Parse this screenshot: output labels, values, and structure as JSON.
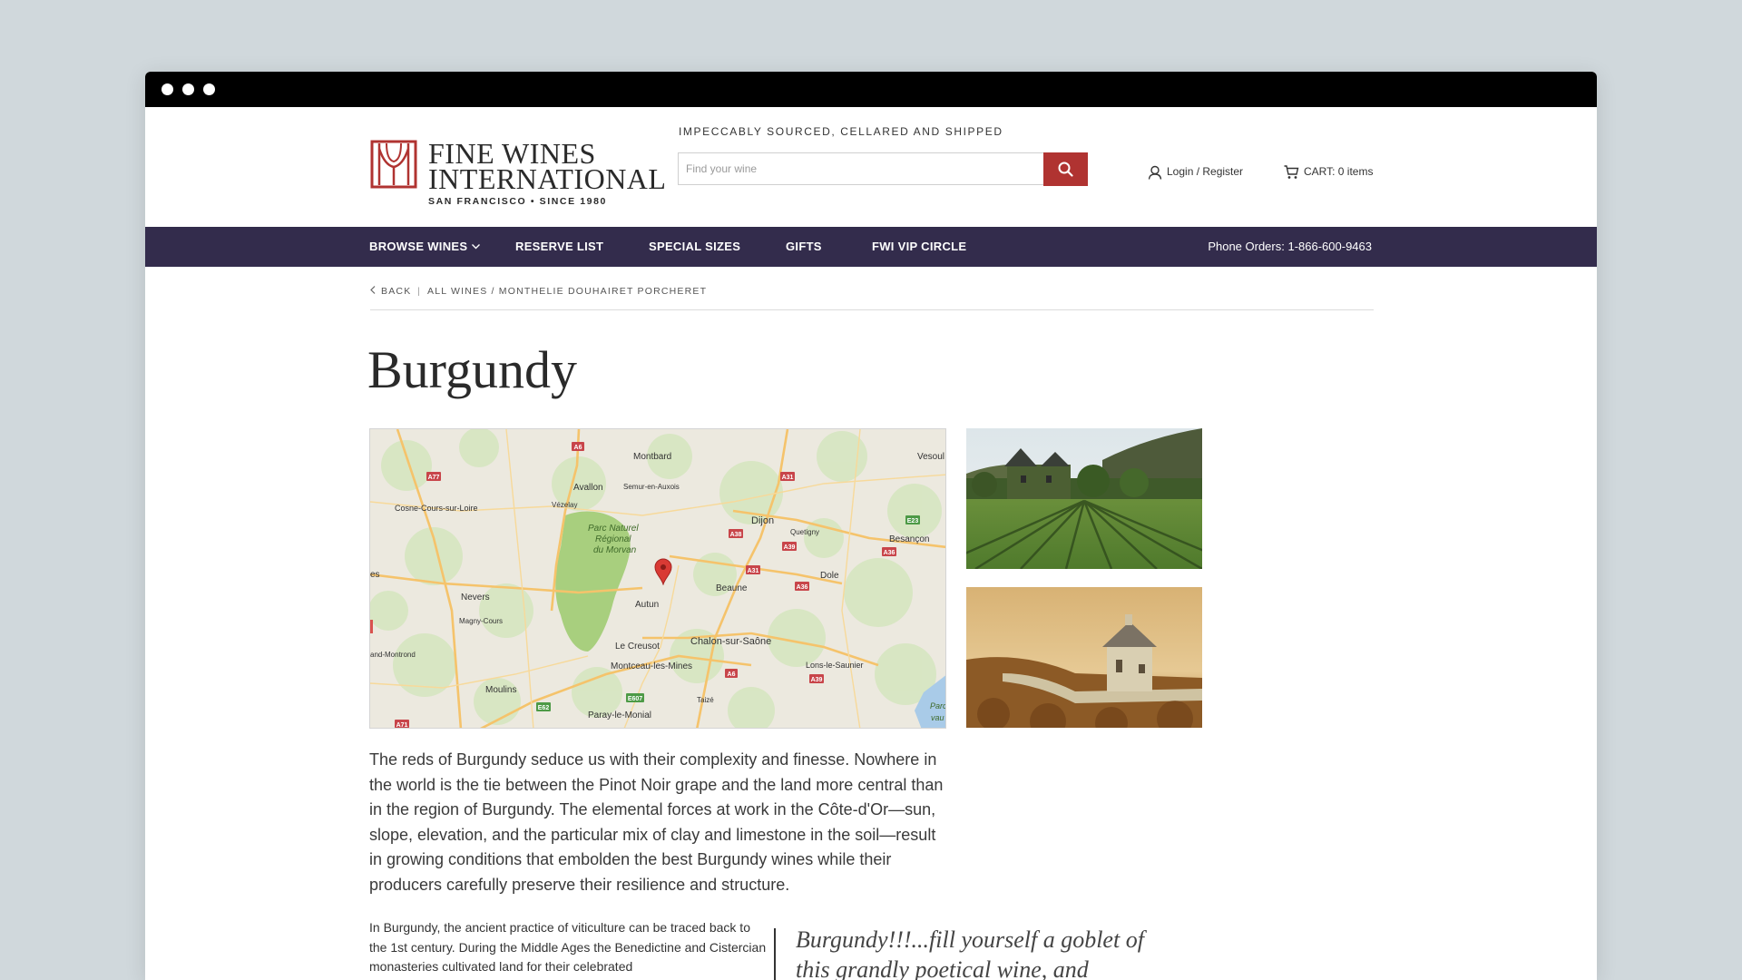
{
  "brand": {
    "line1": "FINE WINES",
    "line2": "INTERNATIONAL",
    "subline": "SAN FRANCISCO • SINCE 1980",
    "accent_color": "#b03331",
    "nav_color": "#332c4c"
  },
  "header": {
    "tagline": "IMPECCABLY SOURCED, CELLARED AND SHIPPED",
    "search_placeholder": "Find your wine",
    "account_label": "Login / Register",
    "cart_label": "CART: 0 items"
  },
  "nav": {
    "items": [
      "BROWSE WINES",
      "RESERVE LIST",
      "SPECIAL SIZES",
      "GIFTS",
      "FWI VIP CIRCLE"
    ],
    "phone": "Phone Orders: 1-866-600-9463"
  },
  "breadcrumb": {
    "back": "BACK",
    "separator": "|",
    "path": "ALL WINES / MONTHELIE DOUHAIRET PORCHERET"
  },
  "page": {
    "title": "Burgundy",
    "lead": "The reds of Burgundy seduce us with their complexity and finesse. Nowhere in the world is the tie between the Pinot Noir grape and the land more central than in the region of Burgundy. The elemental forces at work in the Côte-d'Or—sun, slope, elevation, and the particular mix of clay and limestone in the soil—result in growing conditions that embolden the best Burgundy wines while their producers carefully preserve their resilience and structure.",
    "body": "In Burgundy, the ancient practice of viticulture can be traced back to the 1st century. During the Middle Ages the Benedictine and Cistercian monasteries cultivated land for their celebrated",
    "quote": "Burgundy!!!...fill yourself a goblet of this grandly poetical wine, and"
  },
  "map": {
    "places": [
      "Montbard",
      "Vesoul",
      "Avallon",
      "Semur-en-Auxois",
      "Cosne-Cours-sur-Loire",
      "Vézelay",
      "Parc Naturel",
      "Régional",
      "du Morvan",
      "Dijon",
      "Quetigny",
      "Besançon",
      "Beaune",
      "Dole",
      "Nevers",
      "Magny-Cours",
      "Autun",
      "Le Creusot",
      "Chalon-sur-Saône",
      "Montceau-les-Mines",
      "Lons-le-Saunier",
      "Moulins",
      "Paray-le-Monial",
      "Taizé",
      "and-Montrond",
      "es",
      "Parc",
      "vau"
    ],
    "roads": [
      "A6",
      "A77",
      "A31",
      "E23",
      "A38",
      "A39",
      "A36",
      "A31",
      "A36",
      "A6",
      "A39",
      "E607",
      "E62",
      "A71"
    ]
  }
}
